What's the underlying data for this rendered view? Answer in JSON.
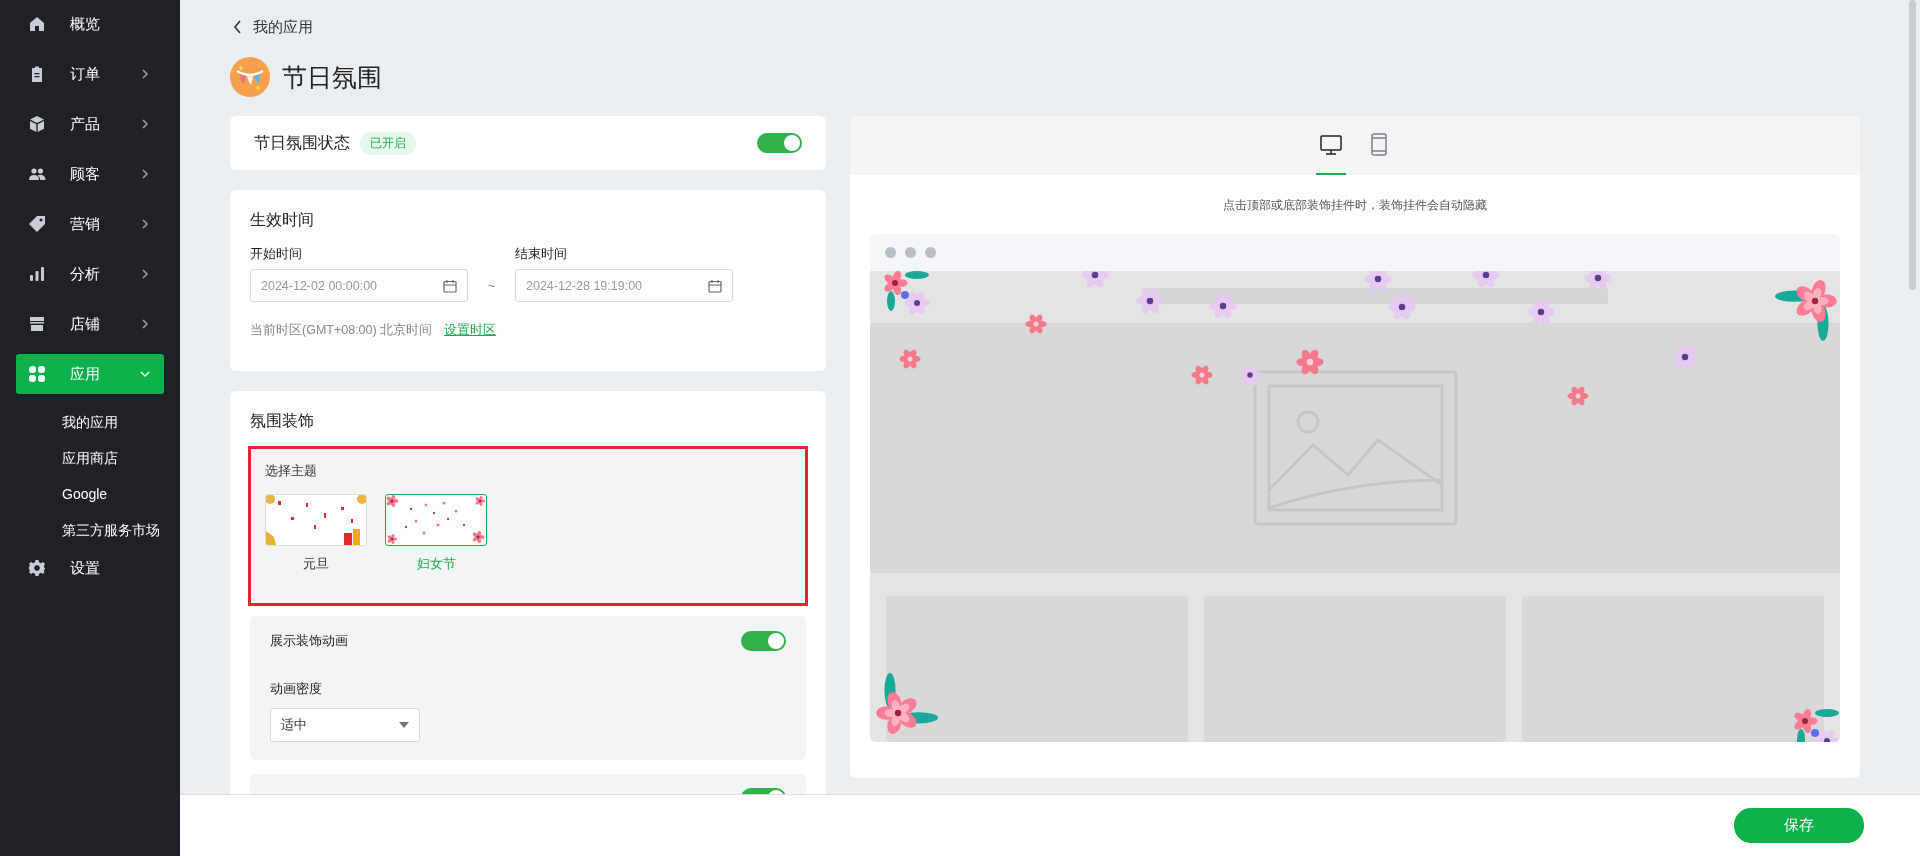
{
  "sidebar": {
    "items": [
      {
        "label": "概览",
        "kind": "link",
        "selected": false
      },
      {
        "label": "订单",
        "kind": "group",
        "selected": false,
        "expanded": false
      },
      {
        "label": "产品",
        "kind": "group",
        "selected": false,
        "expanded": false
      },
      {
        "label": "顾客",
        "kind": "group",
        "selected": false,
        "expanded": false
      },
      {
        "label": "营销",
        "kind": "group",
        "selected": false,
        "expanded": false
      },
      {
        "label": "分析",
        "kind": "group",
        "selected": false,
        "expanded": false
      },
      {
        "label": "店铺",
        "kind": "group",
        "selected": false,
        "expanded": false
      },
      {
        "label": "应用",
        "kind": "group",
        "selected": true,
        "expanded": true,
        "children": [
          {
            "label": "我的应用",
            "selected": false
          },
          {
            "label": "应用商店",
            "selected": false
          },
          {
            "label": "Google",
            "selected": false
          },
          {
            "label": "第三方服务市场",
            "selected": false
          }
        ]
      },
      {
        "label": "设置",
        "kind": "link",
        "selected": false
      }
    ]
  },
  "breadcrumb": "我的应用",
  "title": "节日氛围",
  "status_card": {
    "label": "节日氛围状态",
    "badge": "已开启",
    "on": true
  },
  "time_card": {
    "title": "生效时间",
    "start": {
      "label": "开始时间",
      "placeholder": "2024-12-02 00:00:00"
    },
    "separator": "~",
    "end": {
      "label": "结束时间",
      "placeholder": "2024-12-28 19:19:00"
    },
    "timezone": "当前时区(GMT+08:00) 北京时间",
    "timezone_link": "设置时区"
  },
  "decor_card": {
    "title": "氛围装饰",
    "theme_label": "选择主题",
    "themes": [
      {
        "label": "元旦",
        "selected": false
      },
      {
        "label": "妇女节",
        "selected": true
      }
    ],
    "animation": {
      "label": "展示装饰动画",
      "on": true,
      "density_label": "动画密度",
      "density": "适中"
    },
    "next_section": {
      "on": true
    }
  },
  "preview": {
    "tabs": [
      {
        "selected": true
      },
      {
        "selected": false
      }
    ],
    "hint": "点击顶部或底部装饰挂件时，装饰挂件会自动隐藏"
  },
  "footer": {
    "save": "保存"
  }
}
